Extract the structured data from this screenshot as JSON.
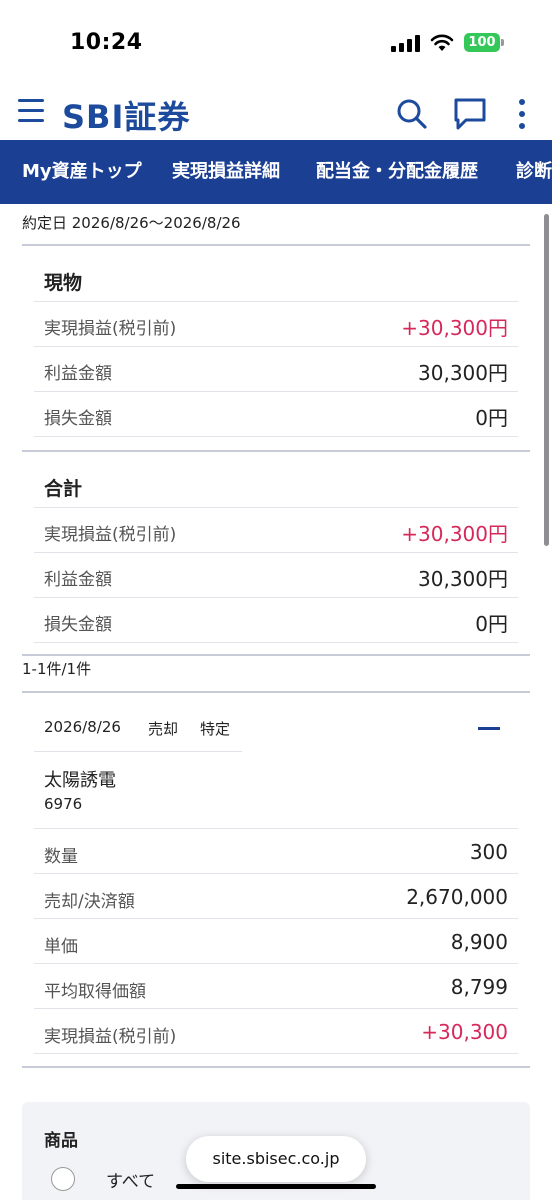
{
  "status": {
    "time": "10:24",
    "battery": "100"
  },
  "header": {
    "logo": "SBI証券"
  },
  "tabs": [
    "My資産トップ",
    "実現損益詳細",
    "配当金・分配金履歴",
    "診断"
  ],
  "date_range": "約定日 2026/8/26〜2026/8/26",
  "genbutsu": {
    "title": "現物",
    "rows": [
      {
        "label": "実現損益(税引前)",
        "value": "+30,300円"
      },
      {
        "label": "利益金額",
        "value": "30,300円"
      },
      {
        "label": "損失金額",
        "value": "0円"
      }
    ]
  },
  "total": {
    "title": "合計",
    "rows": [
      {
        "label": "実現損益(税引前)",
        "value": "+30,300円"
      },
      {
        "label": "利益金額",
        "value": "30,300円"
      },
      {
        "label": "損失金額",
        "value": "0円"
      }
    ]
  },
  "count": "1-1件/1件",
  "trade": {
    "date": "2026/8/26",
    "type": "売却",
    "account": "特定",
    "name": "太陽誘電",
    "code": "6976",
    "rows": [
      {
        "label": "数量",
        "value": "300"
      },
      {
        "label": "売却/決済額",
        "value": "2,670,000"
      },
      {
        "label": "単価",
        "value": "8,900"
      },
      {
        "label": "平均取得価額",
        "value": "8,799"
      },
      {
        "label": "実現損益(税引前)",
        "value": "+30,300"
      }
    ]
  },
  "filter": {
    "title": "商品",
    "option_all": "すべて"
  },
  "url": "site.sbisec.co.jp",
  "colors": {
    "brand": "#1b3f93",
    "positive": "#d6295a"
  }
}
